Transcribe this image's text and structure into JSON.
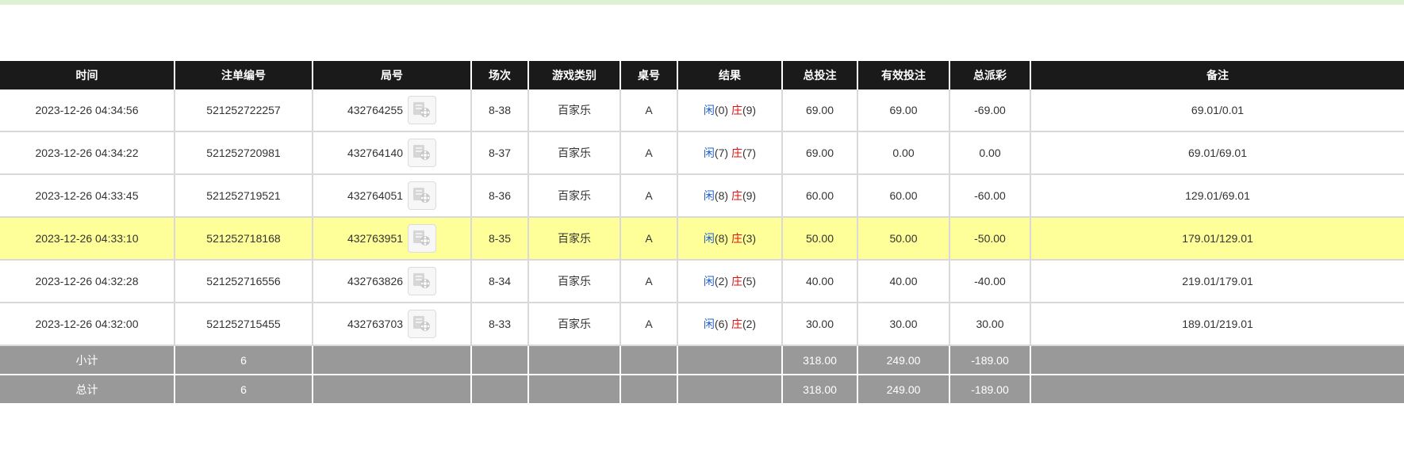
{
  "columns": [
    "时间",
    "注单编号",
    "局号",
    "场次",
    "游戏类别",
    "桌号",
    "结果",
    "总投注",
    "有效投注",
    "总派彩",
    "备注"
  ],
  "rows": [
    {
      "time": "2023-12-26 04:34:56",
      "bet_id": "521252722257",
      "round": "432764255",
      "session": "8-38",
      "game": "百家乐",
      "table": "A",
      "player_label": "闲",
      "player_score": "(0)",
      "banker_label": "庄",
      "banker_score": "(9)",
      "total_bet": "69.00",
      "valid_bet": "69.00",
      "payout": "-69.00",
      "payout_status": "negative",
      "remark": "69.01/0.01",
      "highlight": false
    },
    {
      "time": "2023-12-26 04:34:22",
      "bet_id": "521252720981",
      "round": "432764140",
      "session": "8-37",
      "game": "百家乐",
      "table": "A",
      "player_label": "闲",
      "player_score": "(7)",
      "banker_label": "庄",
      "banker_score": "(7)",
      "total_bet": "69.00",
      "valid_bet": "0.00",
      "payout": "0.00",
      "payout_status": "neutral",
      "remark": "69.01/69.01",
      "highlight": false
    },
    {
      "time": "2023-12-26 04:33:45",
      "bet_id": "521252719521",
      "round": "432764051",
      "session": "8-36",
      "game": "百家乐",
      "table": "A",
      "player_label": "闲",
      "player_score": "(8)",
      "banker_label": "庄",
      "banker_score": "(9)",
      "total_bet": "60.00",
      "valid_bet": "60.00",
      "payout": "-60.00",
      "payout_status": "negative",
      "remark": "129.01/69.01",
      "highlight": false
    },
    {
      "time": "2023-12-26 04:33:10",
      "bet_id": "521252718168",
      "round": "432763951",
      "session": "8-35",
      "game": "百家乐",
      "table": "A",
      "player_label": "闲",
      "player_score": "(8)",
      "banker_label": "庄",
      "banker_score": "(3)",
      "total_bet": "50.00",
      "valid_bet": "50.00",
      "payout": "-50.00",
      "payout_status": "negative",
      "remark": "179.01/129.01",
      "highlight": true
    },
    {
      "time": "2023-12-26 04:32:28",
      "bet_id": "521252716556",
      "round": "432763826",
      "session": "8-34",
      "game": "百家乐",
      "table": "A",
      "player_label": "闲",
      "player_score": "(2)",
      "banker_label": "庄",
      "banker_score": "(5)",
      "total_bet": "40.00",
      "valid_bet": "40.00",
      "payout": "-40.00",
      "payout_status": "negative",
      "remark": "219.01/179.01",
      "highlight": false
    },
    {
      "time": "2023-12-26 04:32:00",
      "bet_id": "521252715455",
      "round": "432763703",
      "session": "8-33",
      "game": "百家乐",
      "table": "A",
      "player_label": "闲",
      "player_score": "(6)",
      "banker_label": "庄",
      "banker_score": "(2)",
      "total_bet": "30.00",
      "valid_bet": "30.00",
      "payout": "30.00",
      "payout_status": "positive",
      "remark": "189.01/219.01",
      "highlight": false
    }
  ],
  "subtotal": {
    "label": "小计",
    "count": "6",
    "total_bet": "318.00",
    "valid_bet": "249.00",
    "payout": "-189.00"
  },
  "total": {
    "label": "总计",
    "count": "6",
    "total_bet": "318.00",
    "valid_bet": "249.00",
    "payout": "-189.00"
  },
  "icons": {
    "round_video": "video-replay-icon"
  },
  "colors": {
    "header_bg": "#1a1a1a",
    "highlight_row": "#ffff99",
    "summary_bg": "#999999",
    "positive_blue": "#1f5fd1",
    "negative_red": "#e01010"
  }
}
